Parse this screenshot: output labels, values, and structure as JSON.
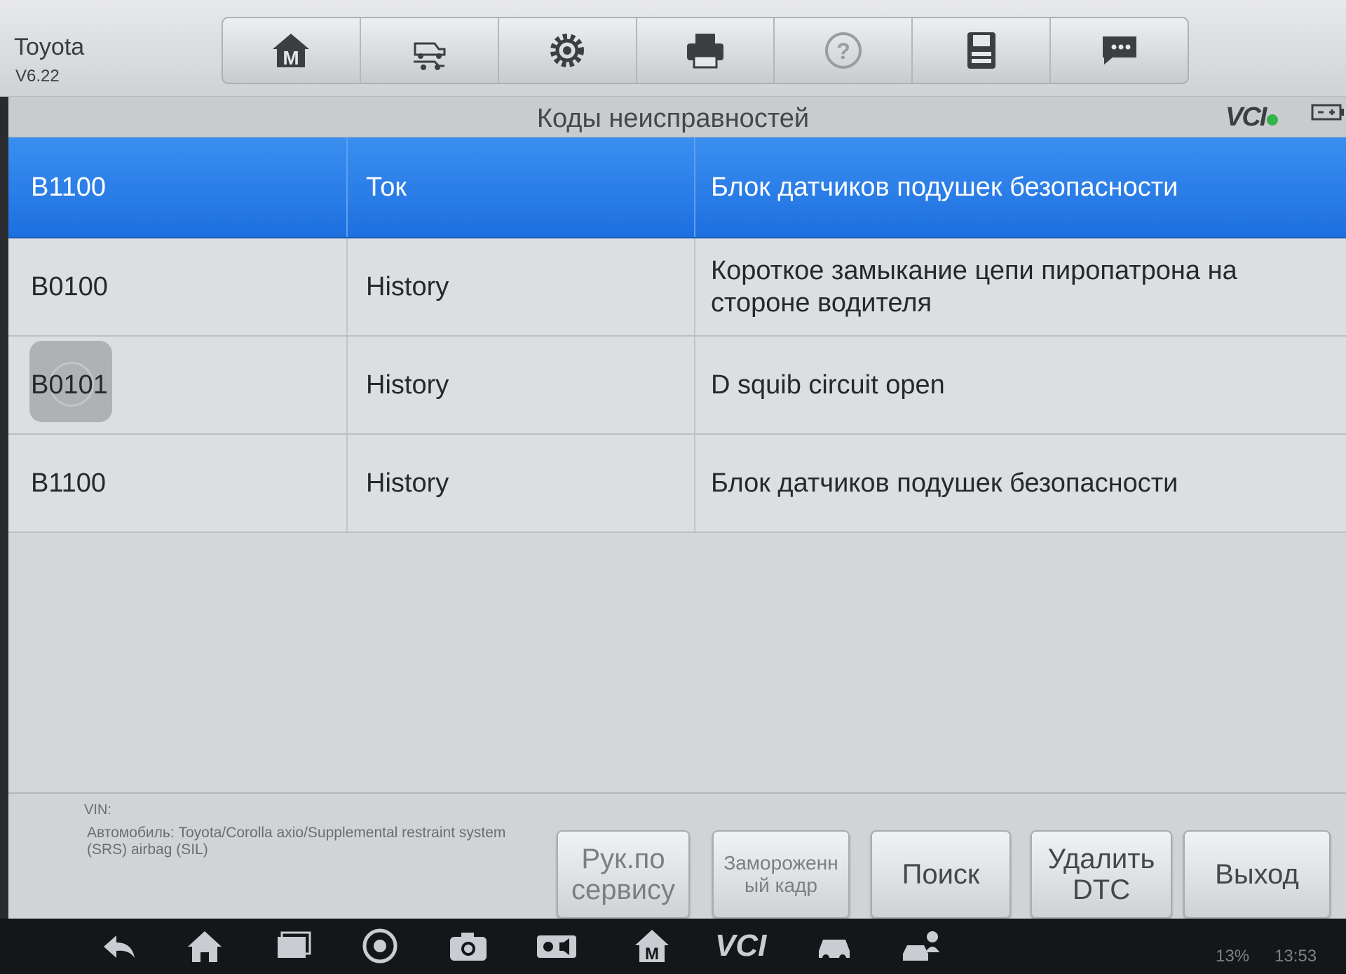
{
  "app": {
    "title": "Toyota",
    "version": "V6.22"
  },
  "toolbar": {
    "items": [
      {
        "icon": "home-m-icon"
      },
      {
        "icon": "vehicle-swap-icon"
      },
      {
        "icon": "settings-gear-icon"
      },
      {
        "icon": "printer-icon"
      },
      {
        "icon": "help-icon"
      },
      {
        "icon": "save-disk-icon"
      },
      {
        "icon": "message-icon"
      }
    ]
  },
  "header": {
    "page_title": "Коды неисправностей",
    "vci_label": "VCI"
  },
  "dtc_list": [
    {
      "code": "B1100",
      "status": "Ток",
      "description": "Блок датчиков подушек безопасности",
      "selected": true
    },
    {
      "code": "B0100",
      "status": "History",
      "description": "Короткое замыкание цепи пиропатрона на стороне водителя",
      "selected": false
    },
    {
      "code": "B0101",
      "status": "History",
      "description": "D squib circuit open",
      "selected": false
    },
    {
      "code": "B1100",
      "status": "History",
      "description": "Блок датчиков подушек безопасности",
      "selected": false
    }
  ],
  "footer": {
    "vin_label": "VIN:",
    "vehicle_label": "Автомобиль: Toyota/Corolla axio/Supplemental restraint system (SRS) airbag (SIL)",
    "buttons": {
      "service_manual": "Рук.по сервису",
      "freeze_frame": "Замороженн ый кадр",
      "search": "Поиск",
      "delete_dtc": "Удалить DTC",
      "exit": "Выход"
    }
  },
  "system_bar": {
    "vci_label": "VCI",
    "battery": "13%",
    "time": "13:53"
  },
  "colors": {
    "selected_row": "#1e6fe0",
    "vci_ok": "#34b34a"
  }
}
